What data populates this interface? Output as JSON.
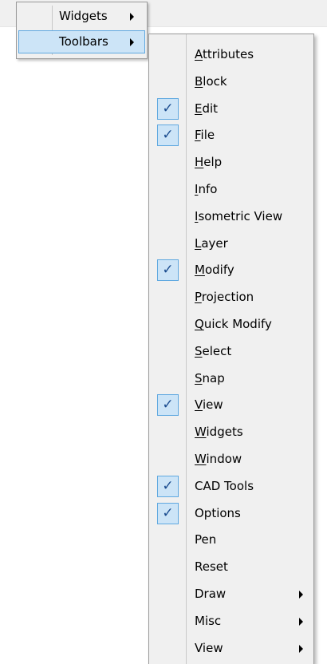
{
  "parent_menu": {
    "items": [
      {
        "label": "Widgets",
        "has_submenu": true,
        "selected": false
      },
      {
        "label": "Toolbars",
        "has_submenu": true,
        "selected": true
      }
    ]
  },
  "toolbars_menu": {
    "items": [
      {
        "pre": "",
        "mn": "A",
        "post": "ttributes",
        "checked": false,
        "submenu": false
      },
      {
        "pre": "",
        "mn": "B",
        "post": "lock",
        "checked": false,
        "submenu": false
      },
      {
        "pre": "",
        "mn": "E",
        "post": "dit",
        "checked": true,
        "submenu": false
      },
      {
        "pre": "",
        "mn": "F",
        "post": "ile",
        "checked": true,
        "submenu": false
      },
      {
        "pre": "",
        "mn": "H",
        "post": "elp",
        "checked": false,
        "submenu": false
      },
      {
        "pre": "",
        "mn": "I",
        "post": "nfo",
        "checked": false,
        "submenu": false
      },
      {
        "pre": "",
        "mn": "I",
        "post": "sometric View",
        "checked": false,
        "submenu": false
      },
      {
        "pre": "",
        "mn": "L",
        "post": "ayer",
        "checked": false,
        "submenu": false
      },
      {
        "pre": "",
        "mn": "M",
        "post": "odify",
        "checked": true,
        "submenu": false
      },
      {
        "pre": "",
        "mn": "P",
        "post": "rojection",
        "checked": false,
        "submenu": false
      },
      {
        "pre": "",
        "mn": "Q",
        "post": "uick Modify",
        "checked": false,
        "submenu": false
      },
      {
        "pre": "",
        "mn": "S",
        "post": "elect",
        "checked": false,
        "submenu": false
      },
      {
        "pre": "",
        "mn": "S",
        "post": "nap",
        "checked": false,
        "submenu": false
      },
      {
        "pre": "",
        "mn": "V",
        "post": "iew",
        "checked": true,
        "submenu": false
      },
      {
        "pre": "",
        "mn": "W",
        "post": "idgets",
        "checked": false,
        "submenu": false
      },
      {
        "pre": "",
        "mn": "W",
        "post": "indow",
        "checked": false,
        "submenu": false
      },
      {
        "pre": "CAD Tools",
        "mn": "",
        "post": "",
        "checked": true,
        "submenu": false
      },
      {
        "pre": "Options",
        "mn": "",
        "post": "",
        "checked": true,
        "submenu": false
      },
      {
        "pre": "Pen",
        "mn": "",
        "post": "",
        "checked": false,
        "submenu": false
      },
      {
        "pre": "Reset",
        "mn": "",
        "post": "",
        "checked": false,
        "submenu": false
      },
      {
        "pre": "Draw",
        "mn": "",
        "post": "",
        "checked": false,
        "submenu": true
      },
      {
        "pre": "Misc",
        "mn": "",
        "post": "",
        "checked": false,
        "submenu": true
      },
      {
        "pre": "View",
        "mn": "",
        "post": "",
        "checked": false,
        "submenu": true
      }
    ]
  },
  "check_glyph": "✓",
  "colors": {
    "menu_bg": "#f0f0f0",
    "highlight_bg": "#cce4f7",
    "highlight_border": "#5fa8e0",
    "check_color": "#1b4c8f"
  }
}
